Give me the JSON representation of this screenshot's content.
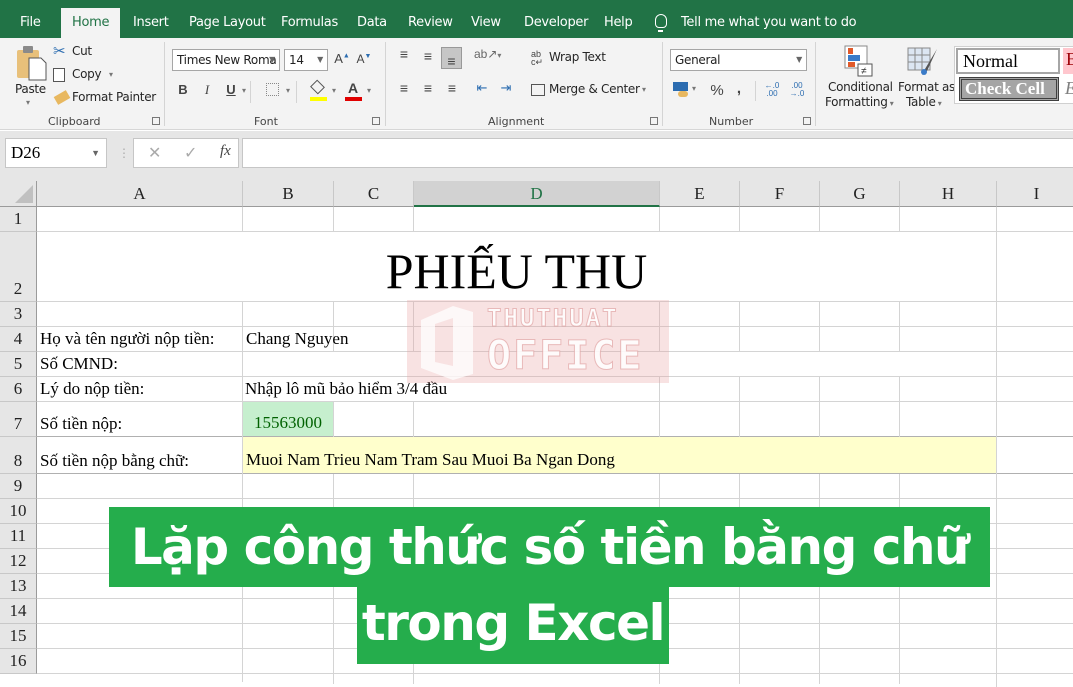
{
  "tabs": [
    {
      "label": "File"
    },
    {
      "label": "Home",
      "active": true
    },
    {
      "label": "Insert"
    },
    {
      "label": "Page Layout"
    },
    {
      "label": "Formulas"
    },
    {
      "label": "Data"
    },
    {
      "label": "Review"
    },
    {
      "label": "View"
    },
    {
      "label": "Developer"
    },
    {
      "label": "Help"
    }
  ],
  "tell_me": "Tell me what you want to do",
  "ribbon": {
    "clipboard": {
      "paste": "Paste",
      "cut": "Cut",
      "copy": "Copy",
      "format_painter": "Format Painter",
      "group": "Clipboard"
    },
    "font": {
      "name": "Times New Roma",
      "size": "14",
      "bold": "B",
      "italic": "I",
      "underline": "U",
      "grow": "A",
      "shrink": "A",
      "font_color": "A",
      "group": "Font"
    },
    "alignment": {
      "wrap_text": "Wrap Text",
      "merge_center": "Merge & Center",
      "group": "Alignment"
    },
    "number": {
      "format": "General",
      "percent": "%",
      "comma": ",",
      "inc_decimal": "←.0 .00",
      "dec_decimal": ".00 →.0",
      "group": "Number"
    },
    "styles": {
      "conditional_1": "Conditional",
      "conditional_2": "Formatting",
      "format_table_1": "Format as",
      "format_table_2": "Table",
      "normal": "Normal",
      "check_cell": "Check Cell",
      "bad": "B",
      "explanatory": "E"
    }
  },
  "formula_bar": {
    "name_box": "D26",
    "cancel": "✕",
    "enter": "✓",
    "fx": "fx",
    "value": ""
  },
  "columns": [
    "A",
    "B",
    "C",
    "D",
    "E",
    "F",
    "G",
    "H",
    "I"
  ],
  "selected_column": "D",
  "rows": [
    "1",
    "2",
    "3",
    "4",
    "5",
    "6",
    "7",
    "8",
    "9",
    "10",
    "11",
    "12",
    "13",
    "14",
    "15",
    "16"
  ],
  "sheet": {
    "title": "PHIẾU THU",
    "a4": "Họ và tên người nộp tiền:",
    "b4": "Chang Nguyen",
    "a5": "Số CMND:",
    "a6": "Lý do nộp tiền:",
    "b6": "Nhập lô mũ bảo hiểm 3/4 đầu",
    "a7": "Số tiền nộp:",
    "b7": "15563000",
    "a8": "Số tiền nộp bằng chữ:",
    "b8": "Muoi Nam Trieu Nam Tram Sau Muoi Ba Ngan  Dong"
  },
  "watermark": {
    "line1": "THUTHUAT",
    "line2": "OFFICE"
  },
  "banner": {
    "line1": "Lặp công thức số tiền bằng chữ",
    "line2": "trong Excel"
  },
  "colors": {
    "excel_green": "#217346",
    "banner_green": "#25ad4c",
    "amount_fill": "#c6efce",
    "amount_text": "#006100",
    "words_fill": "#ffffcc"
  }
}
